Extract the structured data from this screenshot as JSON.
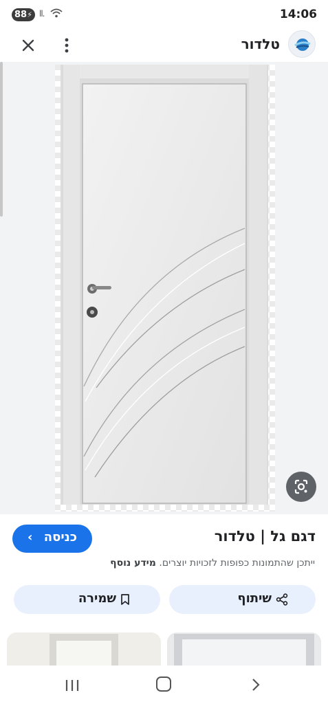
{
  "status_bar": {
    "battery": "88",
    "time": "14:06"
  },
  "header": {
    "site_name": "טלדור"
  },
  "icons": {
    "close": "close-icon",
    "menu": "more-vert-icon",
    "logo": "site-logo-icon",
    "lens": "google-lens-icon",
    "share": "share-icon",
    "save": "bookmark-icon"
  },
  "result": {
    "title": "דגם גל | טלדור",
    "visit_label": "כניסה",
    "copyright_text": "ייתכן שהתמונות כפופות לזכויות יוצרים.",
    "more_info": "מידע נוסף"
  },
  "actions": {
    "share_label": "שיתוף",
    "save_label": "שמירה"
  },
  "colors": {
    "accent": "#1a73e8",
    "pill_bg": "#e8f0fe"
  }
}
